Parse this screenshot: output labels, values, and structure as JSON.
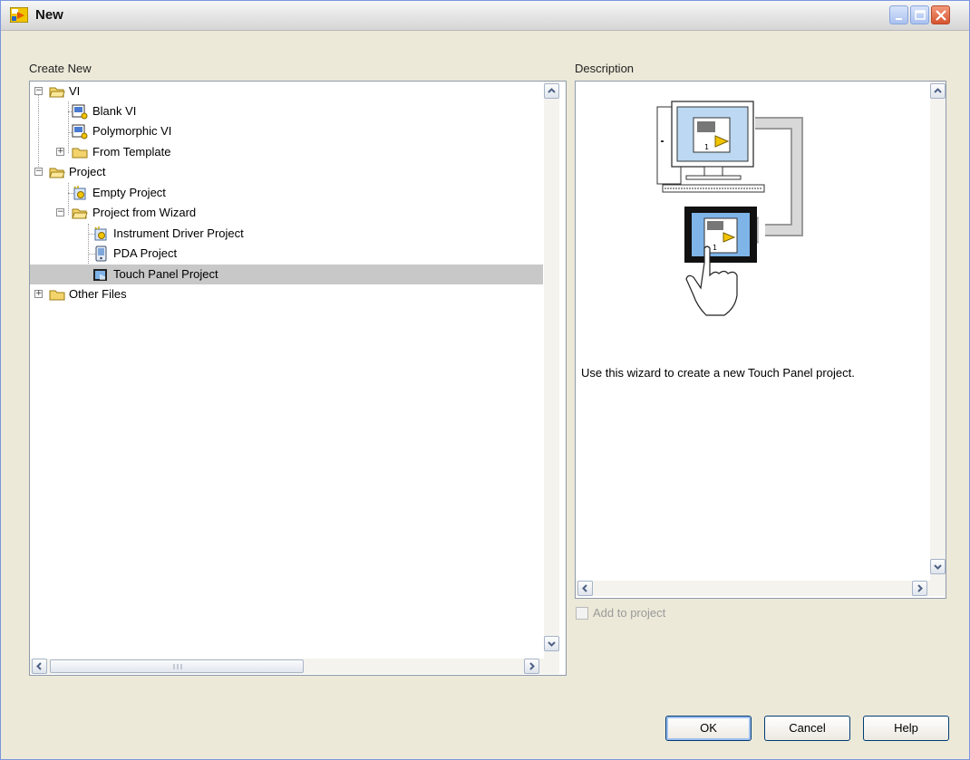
{
  "window": {
    "title": "New",
    "controls": {
      "minimize_icon": "minimize-icon",
      "maximize_icon": "maximize-icon",
      "close_icon": "close-icon"
    }
  },
  "create_new": {
    "label": "Create New",
    "tree": [
      {
        "label": "VI",
        "depth": 0,
        "icon": "folder-open-icon",
        "expander": "minus"
      },
      {
        "label": "Blank VI",
        "depth": 1,
        "icon": "vi-icon"
      },
      {
        "label": "Polymorphic VI",
        "depth": 1,
        "icon": "vi-icon"
      },
      {
        "label": "From Template",
        "depth": 1,
        "icon": "folder-icon",
        "expander": "plus"
      },
      {
        "label": "Project",
        "depth": 0,
        "icon": "folder-open-icon",
        "expander": "minus"
      },
      {
        "label": "Empty Project",
        "depth": 1,
        "icon": "project-icon"
      },
      {
        "label": "Project from Wizard",
        "depth": 1,
        "icon": "folder-open-icon",
        "expander": "minus"
      },
      {
        "label": "Instrument Driver Project",
        "depth": 2,
        "icon": "project-wizard-icon"
      },
      {
        "label": "PDA Project",
        "depth": 2,
        "icon": "pda-icon"
      },
      {
        "label": "Touch Panel Project",
        "depth": 2,
        "icon": "touch-panel-icon",
        "selected": true
      },
      {
        "label": "Other Files",
        "depth": 0,
        "icon": "folder-icon",
        "expander": "plus"
      }
    ]
  },
  "description": {
    "label": "Description",
    "text": "Use this wizard to create a new Touch Panel project.",
    "illustration": "touch-panel-deploy-illustration"
  },
  "add_to_project": {
    "label": "Add to project",
    "checked": false,
    "enabled": false
  },
  "buttons": {
    "ok": "OK",
    "cancel": "Cancel",
    "help": "Help"
  }
}
